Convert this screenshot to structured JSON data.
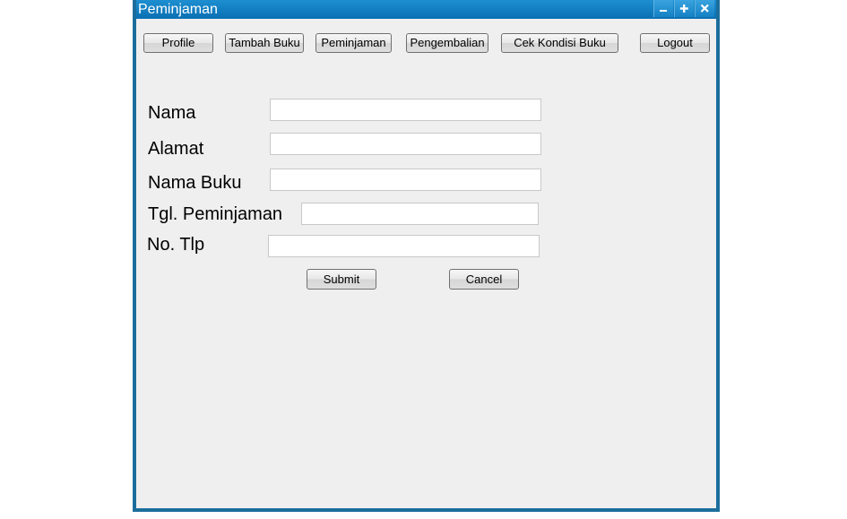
{
  "window": {
    "title": "Peminjaman"
  },
  "icons": {
    "minimize": "minimize-icon",
    "maximize": "maximize-icon",
    "close": "close-icon"
  },
  "nav": {
    "profile": "Profile",
    "tambah_buku": "Tambah Buku",
    "peminjaman": "Peminjaman",
    "pengembalian": "Pengembalian",
    "cek_kondisi_buku": "Cek Kondisi Buku",
    "logout": "Logout"
  },
  "form": {
    "nama": {
      "label": "Nama",
      "value": ""
    },
    "alamat": {
      "label": "Alamat",
      "value": ""
    },
    "nama_buku": {
      "label": "Nama Buku",
      "value": ""
    },
    "tgl_peminjaman": {
      "label": "Tgl. Peminjaman",
      "value": ""
    },
    "no_tlp": {
      "label": "No. Tlp",
      "value": ""
    }
  },
  "actions": {
    "submit": "Submit",
    "cancel": "Cancel"
  },
  "colors": {
    "titlebar": "#0a6fb3",
    "window_border": "#1b6e9c",
    "window_background": "#efefef"
  }
}
